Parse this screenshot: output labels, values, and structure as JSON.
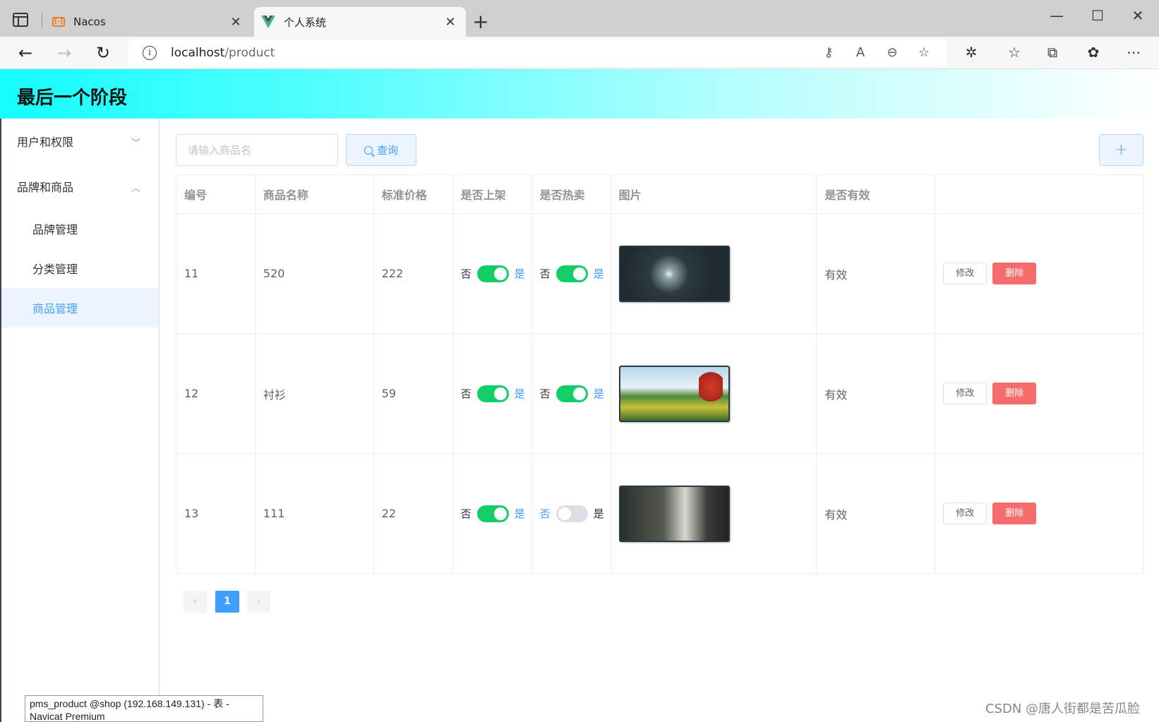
{
  "browser": {
    "tabs": [
      {
        "title": "Nacos",
        "favicon": "nacos-icon"
      },
      {
        "title": "个人系统",
        "favicon": "vue-icon",
        "active": true
      }
    ],
    "url_host": "localhost",
    "url_path": "/product"
  },
  "app": {
    "title": "最后一个阶段"
  },
  "sidebar": {
    "groups": [
      {
        "label": "用户和权限",
        "expanded": false
      },
      {
        "label": "品牌和商品",
        "expanded": true,
        "items": [
          "品牌管理",
          "分类管理",
          "商品管理"
        ],
        "active_item": "商品管理"
      }
    ]
  },
  "toolbar": {
    "search_placeholder": "请输入商品名",
    "search_label": "查询",
    "add_label": "+"
  },
  "table": {
    "columns": [
      "编号",
      "商品名称",
      "标准价格",
      "是否上架",
      "是否热卖",
      "图片",
      "是否有效",
      ""
    ],
    "switch_off_label": "否",
    "switch_on_label": "是",
    "edit_label": "修改",
    "delete_label": "删除",
    "rows": [
      {
        "id": "11",
        "name": "520",
        "price": "222",
        "on_sale": true,
        "hot": true,
        "valid": "有效"
      },
      {
        "id": "12",
        "name": "衬衫",
        "price": "59",
        "on_sale": true,
        "hot": true,
        "valid": "有效"
      },
      {
        "id": "13",
        "name": "111",
        "price": "22",
        "on_sale": true,
        "hot": false,
        "valid": "有效"
      }
    ]
  },
  "pagination": {
    "prev": "‹",
    "current": "1",
    "next": "›"
  },
  "overlay": {
    "tooltip_line1": "pms_product @shop (192.168.149.131) - 表 -",
    "tooltip_line2": "Navicat Premium",
    "watermark": "CSDN @唐人街都是苦瓜脸"
  },
  "colors": {
    "primary": "#409eff",
    "success": "#13ce66",
    "danger": "#f56c6c",
    "header_gradient_start": "#14fdfd"
  }
}
